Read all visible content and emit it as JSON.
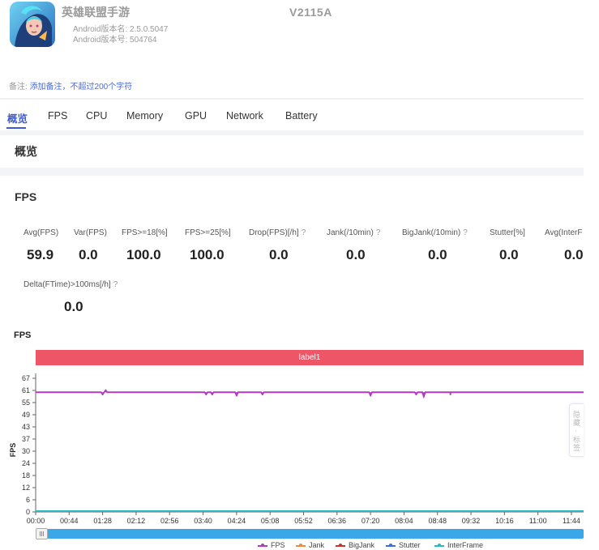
{
  "app": {
    "name": "英雄联盟手游",
    "version_name": "Android版本名: 2.5.0.5047",
    "version_code": "Android版本号: 504764",
    "device": "V2115A"
  },
  "note": {
    "label": "备注:",
    "link": "添加备注，不超过200个字符"
  },
  "tabs": [
    {
      "label": "概览",
      "active": true
    },
    {
      "label": "FPS"
    },
    {
      "label": "CPU"
    },
    {
      "label": "Memory"
    },
    {
      "label": "GPU"
    },
    {
      "label": "Network"
    },
    {
      "label": "Battery"
    }
  ],
  "overview_title": "概览",
  "fps_section_title": "FPS",
  "metrics": [
    {
      "label": "Avg(FPS)",
      "value": "59.9"
    },
    {
      "label": "Var(FPS)",
      "value": "0.0"
    },
    {
      "label": "FPS>=18[%]",
      "value": "100.0"
    },
    {
      "label": "FPS>=25[%]",
      "value": "100.0"
    },
    {
      "label": "Drop(FPS)[/h]",
      "value": "0.0",
      "help": "?"
    },
    {
      "label": "Jank(/10min)",
      "value": "0.0",
      "help": "?"
    },
    {
      "label": "BigJank(/10min)",
      "value": "0.0",
      "help": "?"
    },
    {
      "label": "Stutter[%]",
      "value": "0.0"
    },
    {
      "label": "Avg(InterF",
      "value": "0.0"
    },
    {
      "label": "Delta(FTime)>100ms[/h]",
      "value": "0.0",
      "help": "?"
    }
  ],
  "chart_title": "FPS",
  "side_tab": "隐藏 · 标签",
  "chart_data": {
    "type": "line",
    "band_label": "label1",
    "ylabel": "FPS",
    "ylim": [
      0,
      67
    ],
    "yticks": [
      "0",
      "6",
      "12",
      "18",
      "24",
      "30",
      "37",
      "43",
      "49",
      "55",
      "61",
      "67"
    ],
    "x": [
      "00:00",
      "00:44",
      "01:28",
      "02:12",
      "02:56",
      "03:40",
      "04:24",
      "05:08",
      "05:52",
      "06:36",
      "07:20",
      "08:04",
      "08:48",
      "09:32",
      "10:16",
      "11:00",
      "11:44"
    ],
    "xlim_seconds": [
      0,
      720
    ],
    "series": [
      {
        "name": "FPS",
        "color": "#b23cc0",
        "baseline": 60,
        "dips": [
          [
            88,
            59
          ],
          [
            92,
            61
          ],
          [
            224,
            59
          ],
          [
            232,
            59
          ],
          [
            264,
            58.5
          ],
          [
            298,
            59
          ],
          [
            440,
            58.5
          ],
          [
            500,
            59
          ],
          [
            510,
            58
          ],
          [
            545,
            59
          ]
        ]
      },
      {
        "name": "Jank",
        "color": "#f08a3c",
        "values": [
          0
        ]
      },
      {
        "name": "BigJank",
        "color": "#c0392b",
        "values": [
          0
        ]
      },
      {
        "name": "Stutter",
        "color": "#3b6fd6",
        "values": [
          0
        ]
      },
      {
        "name": "InterFrame",
        "color": "#28b8c8",
        "values": [
          0
        ]
      }
    ]
  }
}
